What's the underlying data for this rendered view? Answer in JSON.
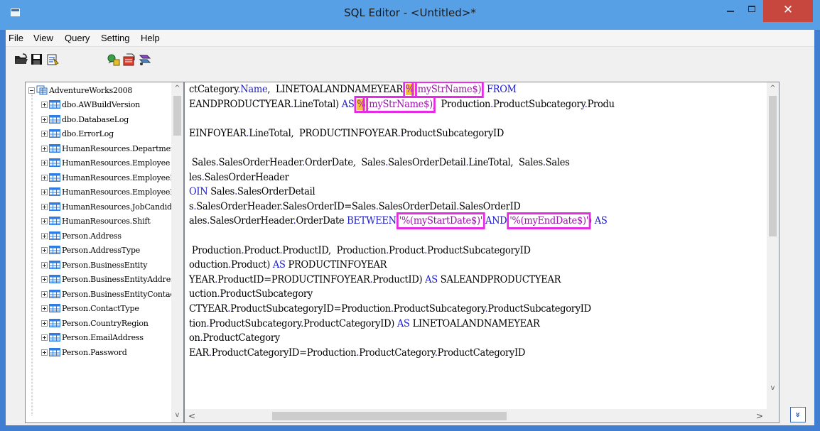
{
  "window": {
    "title": "SQL Editor - <Untitled>*",
    "accent": "#57a0e6",
    "close_color": "#c7463e",
    "minimize_icon": "minimize-icon",
    "maximize_icon": "maximize-icon",
    "close_icon": "close-icon",
    "close_label": "✕"
  },
  "menu": {
    "items": [
      "File",
      "View",
      "Query",
      "Setting",
      "Help"
    ]
  },
  "toolbar": {
    "tools": [
      {
        "name": "open-folder-icon"
      },
      {
        "name": "save-icon"
      },
      {
        "name": "execute-query-icon"
      },
      {
        "name": "query-builder-icon"
      },
      {
        "name": "import-data-icon"
      },
      {
        "name": "options-icon"
      }
    ]
  },
  "tree": {
    "root": "AdventureWorks2008",
    "items": [
      "dbo.AWBuildVersion",
      "dbo.DatabaseLog",
      "dbo.ErrorLog",
      "HumanResources.Department",
      "HumanResources.Employee",
      "HumanResources.EmployeeDepartmentHistory",
      "HumanResources.EmployeePayHistory",
      "HumanResources.JobCandidate",
      "HumanResources.Shift",
      "Person.Address",
      "Person.AddressType",
      "Person.BusinessEntity",
      "Person.BusinessEntityAddress",
      "Person.BusinessEntityContact",
      "Person.ContactType",
      "Person.CountryRegion",
      "Person.EmailAddress",
      "Person.Password"
    ],
    "table_icon_color": "#2f7de0"
  },
  "editor": {
    "highlight_color": "#e52ce5",
    "keyword_color": "#1a1ad0",
    "variable_color": "#9a13a8",
    "lines": [
      {
        "seg": [
          [
            "ctCategory",
            "t"
          ],
          [
            ".",
            "k"
          ],
          [
            "Name",
            "k"
          ],
          [
            ",  LINETOALANDNAMEYEAR",
            "t"
          ],
          [
            ".",
            "k"
          ],
          [
            "%",
            "h1"
          ],
          [
            "(myStrName$)",
            "h1v"
          ],
          [
            "  FROM",
            "k"
          ]
        ]
      },
      {
        "seg": [
          [
            "EANDPRODUCTYEAR",
            "t"
          ],
          [
            ".",
            "k"
          ],
          [
            "LineTotal) ",
            "t"
          ],
          [
            "AS ",
            "k"
          ],
          [
            "%",
            "h2"
          ],
          [
            "(myStrName$)",
            "h2v"
          ],
          [
            ",  Production",
            "t"
          ],
          [
            ".",
            "k"
          ],
          [
            "ProductSubcategory",
            "t"
          ],
          [
            ".",
            "k"
          ],
          [
            "Produ",
            "t"
          ]
        ]
      },
      {
        "seg": []
      },
      {
        "seg": [
          [
            "EINFOYEAR",
            "t"
          ],
          [
            ".",
            "k"
          ],
          [
            "LineTotal,  PRODUCTINFOYEAR",
            "t"
          ],
          [
            ".",
            "k"
          ],
          [
            "ProductSubcategoryID",
            "t"
          ]
        ]
      },
      {
        "seg": []
      },
      {
        "seg": [
          [
            " Sales",
            "t"
          ],
          [
            ".",
            "k"
          ],
          [
            "SalesOrderHeader",
            "t"
          ],
          [
            ".",
            "k"
          ],
          [
            "OrderDate,  Sales",
            "t"
          ],
          [
            ".",
            "k"
          ],
          [
            "SalesOrderDetail",
            "t"
          ],
          [
            ".",
            "k"
          ],
          [
            "LineTotal,  Sales",
            "t"
          ],
          [
            ".",
            "k"
          ],
          [
            "Sales",
            "t"
          ]
        ]
      },
      {
        "seg": [
          [
            "les",
            "t"
          ],
          [
            ".",
            "k"
          ],
          [
            "SalesOrderHeader",
            "t"
          ]
        ]
      },
      {
        "seg": [
          [
            "OIN ",
            "k"
          ],
          [
            "Sales",
            "t"
          ],
          [
            ".",
            "k"
          ],
          [
            "SalesOrderDetail",
            "t"
          ]
        ]
      },
      {
        "seg": [
          [
            "s",
            "t"
          ],
          [
            ".",
            "k"
          ],
          [
            "SalesOrderHeader",
            "t"
          ],
          [
            ".",
            "k"
          ],
          [
            "SalesOrderID=Sales",
            "t"
          ],
          [
            ".",
            "k"
          ],
          [
            "SalesOrderDetail",
            "t"
          ],
          [
            ".",
            "k"
          ],
          [
            "SalesOrderID",
            "t"
          ]
        ]
      },
      {
        "seg": [
          [
            "ales",
            "t"
          ],
          [
            ".",
            "k"
          ],
          [
            "SalesOrderHeader",
            "t"
          ],
          [
            ".",
            "k"
          ],
          [
            "OrderDate ",
            "t"
          ],
          [
            "BETWEEN ",
            "k"
          ],
          [
            "'%(myStartDate$)'",
            "h3"
          ],
          [
            " AND ",
            "k"
          ],
          [
            "'%(myEndDate$)'",
            "h4"
          ],
          [
            ") AS",
            "k"
          ]
        ]
      },
      {
        "seg": []
      },
      {
        "seg": [
          [
            " Production",
            "t"
          ],
          [
            ".",
            "k"
          ],
          [
            "Product",
            "t"
          ],
          [
            ".",
            "k"
          ],
          [
            "ProductID,  Production",
            "t"
          ],
          [
            ".",
            "k"
          ],
          [
            "Product",
            "t"
          ],
          [
            ".",
            "k"
          ],
          [
            "ProductSubcategoryID",
            "t"
          ]
        ]
      },
      {
        "seg": [
          [
            "oduction",
            "t"
          ],
          [
            ".",
            "k"
          ],
          [
            "Product) ",
            "t"
          ],
          [
            "AS ",
            "k"
          ],
          [
            "PRODUCTINFOYEAR",
            "t"
          ]
        ]
      },
      {
        "seg": [
          [
            "YEAR",
            "t"
          ],
          [
            ".",
            "k"
          ],
          [
            "ProductID=PRODUCTINFOYEAR",
            "t"
          ],
          [
            ".",
            "k"
          ],
          [
            "ProductID) ",
            "t"
          ],
          [
            "AS ",
            "k"
          ],
          [
            "SALEANDPRODUCTYEAR",
            "t"
          ]
        ]
      },
      {
        "seg": [
          [
            "uction",
            "t"
          ],
          [
            ".",
            "k"
          ],
          [
            "ProductSubcategory",
            "t"
          ]
        ]
      },
      {
        "seg": [
          [
            "CTYEAR",
            "t"
          ],
          [
            ".",
            "k"
          ],
          [
            "ProductSubcategoryID=Production",
            "t"
          ],
          [
            ".",
            "k"
          ],
          [
            "ProductSubcategory",
            "t"
          ],
          [
            ".",
            "k"
          ],
          [
            "ProductSubcategoryID",
            "t"
          ]
        ]
      },
      {
        "seg": [
          [
            "tion",
            "t"
          ],
          [
            ".",
            "k"
          ],
          [
            "ProductSubcategory",
            "t"
          ],
          [
            ".",
            "k"
          ],
          [
            "ProductCategoryID) ",
            "t"
          ],
          [
            "AS ",
            "k"
          ],
          [
            "LINETOALANDNAMEYEAR",
            "t"
          ]
        ]
      },
      {
        "seg": [
          [
            "on",
            "t"
          ],
          [
            ".",
            "k"
          ],
          [
            "ProductCategory",
            "t"
          ]
        ]
      },
      {
        "seg": [
          [
            "EAR",
            "t"
          ],
          [
            ".",
            "k"
          ],
          [
            "ProductCategoryID=Production",
            "t"
          ],
          [
            ".",
            "k"
          ],
          [
            "ProductCategory",
            "t"
          ],
          [
            ".",
            "k"
          ],
          [
            "ProductCategoryID",
            "t"
          ]
        ]
      }
    ]
  },
  "scroll": {
    "up_arrow": "^",
    "down_arrow": "v",
    "left_arrow": "<",
    "right_arrow": ">"
  },
  "status": {
    "expand_icon": "double-chevron-down-icon",
    "expand_label": "»"
  }
}
